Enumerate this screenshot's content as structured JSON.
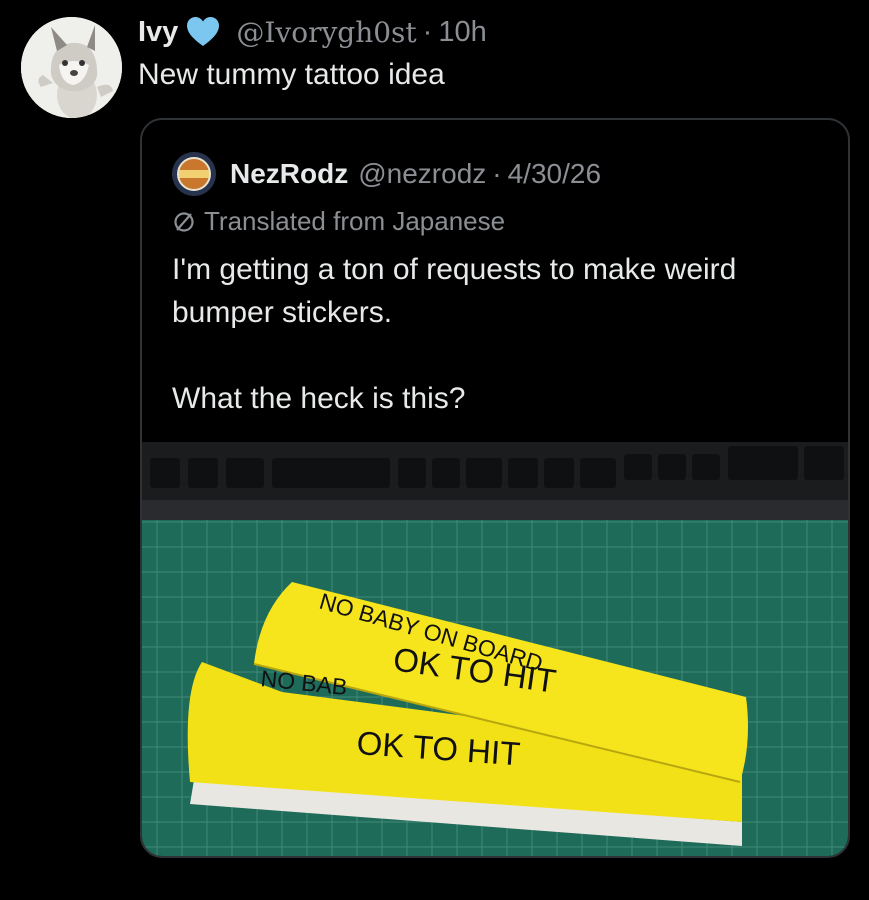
{
  "tweet": {
    "author_name": "Ivy",
    "handle": "@Ivorygh0st",
    "separator": "·",
    "time": "10h",
    "text": "New tummy tattoo idea",
    "avatar_icon": "plush-wolf-avatar",
    "badge_icon": "light-blue-heart-icon",
    "badge_color": "#7cc7f0"
  },
  "quote": {
    "author_name": "NezRodz",
    "handle": "@nezrodz",
    "separator": "·",
    "date": "4/30/26",
    "translated_label": "Translated from Japanese",
    "text_line1": "I'm getting a ton of requests to make weird bumper stickers.",
    "text_line2": "What the heck is this?",
    "image": {
      "sticker_top_line1": "NO BABY ON BOARD",
      "sticker_top_line2": "OK TO HIT",
      "sticker_bottom_line1_partial": "NO BAB",
      "sticker_bottom_line2": "OK TO HIT",
      "sticker_color": "#f3e117",
      "mat_color": "#1f6b5a"
    }
  }
}
